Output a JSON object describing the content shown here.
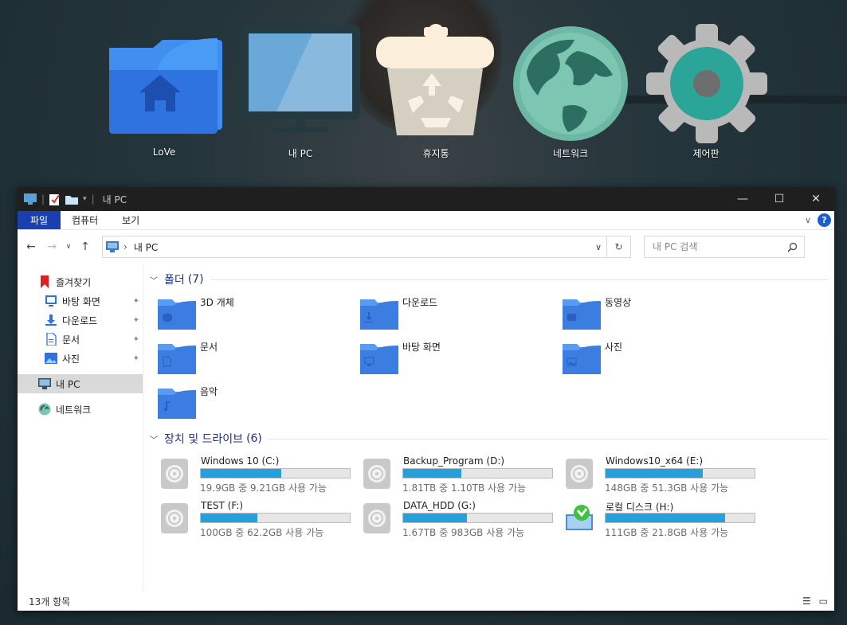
{
  "desktop": {
    "icons": [
      {
        "label": "LoVe",
        "icon": "home-folder-icon"
      },
      {
        "label": "내 PC",
        "icon": "monitor-icon"
      },
      {
        "label": "휴지통",
        "icon": "recycle-bin-icon"
      },
      {
        "label": "네트워크",
        "icon": "globe-icon"
      },
      {
        "label": "제어판",
        "icon": "gear-icon"
      }
    ]
  },
  "window": {
    "title": "내 PC",
    "quick_access_sep": "|",
    "controls": {
      "minimize": "—",
      "maximize": "☐",
      "close": "✕"
    }
  },
  "ribbon": {
    "tabs": [
      "파일",
      "컴퓨터",
      "보기"
    ],
    "expand_glyph": "∨",
    "help": "?"
  },
  "address": {
    "back": "←",
    "forward": "→",
    "recent": "∨",
    "up": "↑",
    "separator": "›",
    "path": "내 PC",
    "dropdown": "∨",
    "refresh": "↻"
  },
  "search": {
    "placeholder": "내 PC 검색",
    "icon": "search-icon"
  },
  "nav": {
    "favorites": "즐겨찾기",
    "pinned": [
      "바탕 화면",
      "다운로드",
      "문서",
      "사진"
    ],
    "this_pc": "내 PC",
    "network": "네트워크",
    "pin_glyph": "📌"
  },
  "folders_group": {
    "title": "폴더",
    "count": "(7)"
  },
  "folders": [
    {
      "name": "3D 개체",
      "icon": "3d-objects-icon"
    },
    {
      "name": "다운로드",
      "icon": "download-icon"
    },
    {
      "name": "동영상",
      "icon": "video-icon"
    },
    {
      "name": "문서",
      "icon": "document-icon"
    },
    {
      "name": "바탕 화면",
      "icon": "desktop-icon"
    },
    {
      "name": "사진",
      "icon": "picture-icon"
    },
    {
      "name": "음악",
      "icon": "music-icon"
    }
  ],
  "drives_group": {
    "title": "장치 및 드라이브",
    "count": "(6)"
  },
  "drives": [
    {
      "name": "Windows 10 (C:)",
      "status": "19.9GB 중 9.21GB 사용 가능",
      "used_fraction": 0.54
    },
    {
      "name": "Backup_Program (D:)",
      "status": "1.81TB 중 1.10TB 사용 가능",
      "used_fraction": 0.39
    },
    {
      "name": "Windows10_x64 (E:)",
      "status": "148GB 중 51.3GB 사용 가능",
      "used_fraction": 0.65
    },
    {
      "name": "TEST (F:)",
      "status": "100GB 중 62.2GB 사용 가능",
      "used_fraction": 0.38
    },
    {
      "name": "DATA_HDD (G:)",
      "status": "1.67TB 중 983GB 사용 가능",
      "used_fraction": 0.43
    },
    {
      "name": "로컬 디스크 (H:)",
      "status": "111GB 중 21.8GB 사용 가능",
      "used_fraction": 0.8
    }
  ],
  "status": {
    "count": "13개 항목"
  },
  "colors": {
    "accent": "#1a3fb0",
    "folder": "#3b7de0",
    "bar": "#26a0da"
  }
}
